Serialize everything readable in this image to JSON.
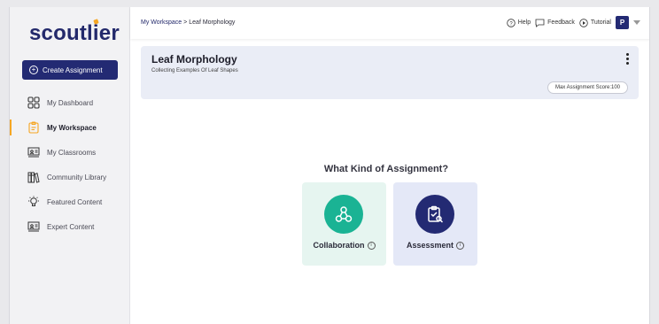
{
  "brand": {
    "logo_text_a": "scoutl",
    "logo_text_b": "i",
    "logo_text_c": "er",
    "accent": "#f5a623",
    "primary": "#232a73",
    "teal": "#1ab394"
  },
  "sidebar": {
    "create_label": "Create Assignment",
    "items": [
      {
        "label": "My Dashboard",
        "icon": "grid-icon"
      },
      {
        "label": "My Workspace",
        "icon": "clipboard-icon",
        "active": true
      },
      {
        "label": "My Classrooms",
        "icon": "classroom-icon"
      },
      {
        "label": "Community Library",
        "icon": "library-icon"
      },
      {
        "label": "Featured Content",
        "icon": "lightbulb-icon"
      },
      {
        "label": "Expert Content",
        "icon": "presentation-icon"
      }
    ]
  },
  "topbar": {
    "breadcrumb_root": "My Workspace",
    "breadcrumb_sep": ">",
    "breadcrumb_current": "Leaf Morphology",
    "help": "Help",
    "feedback": "Feedback",
    "tutorial": "Tutorial",
    "avatar": "P"
  },
  "assignment": {
    "title": "Leaf Morphology",
    "subtitle": "Collecting Examples Of Leaf Shapes",
    "score_label": "Max Assignment Score:100"
  },
  "chooser": {
    "question": "What Kind of Assignment?",
    "options": [
      {
        "label": "Collaboration",
        "icon": "collaboration-icon"
      },
      {
        "label": "Assessment",
        "icon": "assessment-icon"
      }
    ]
  }
}
